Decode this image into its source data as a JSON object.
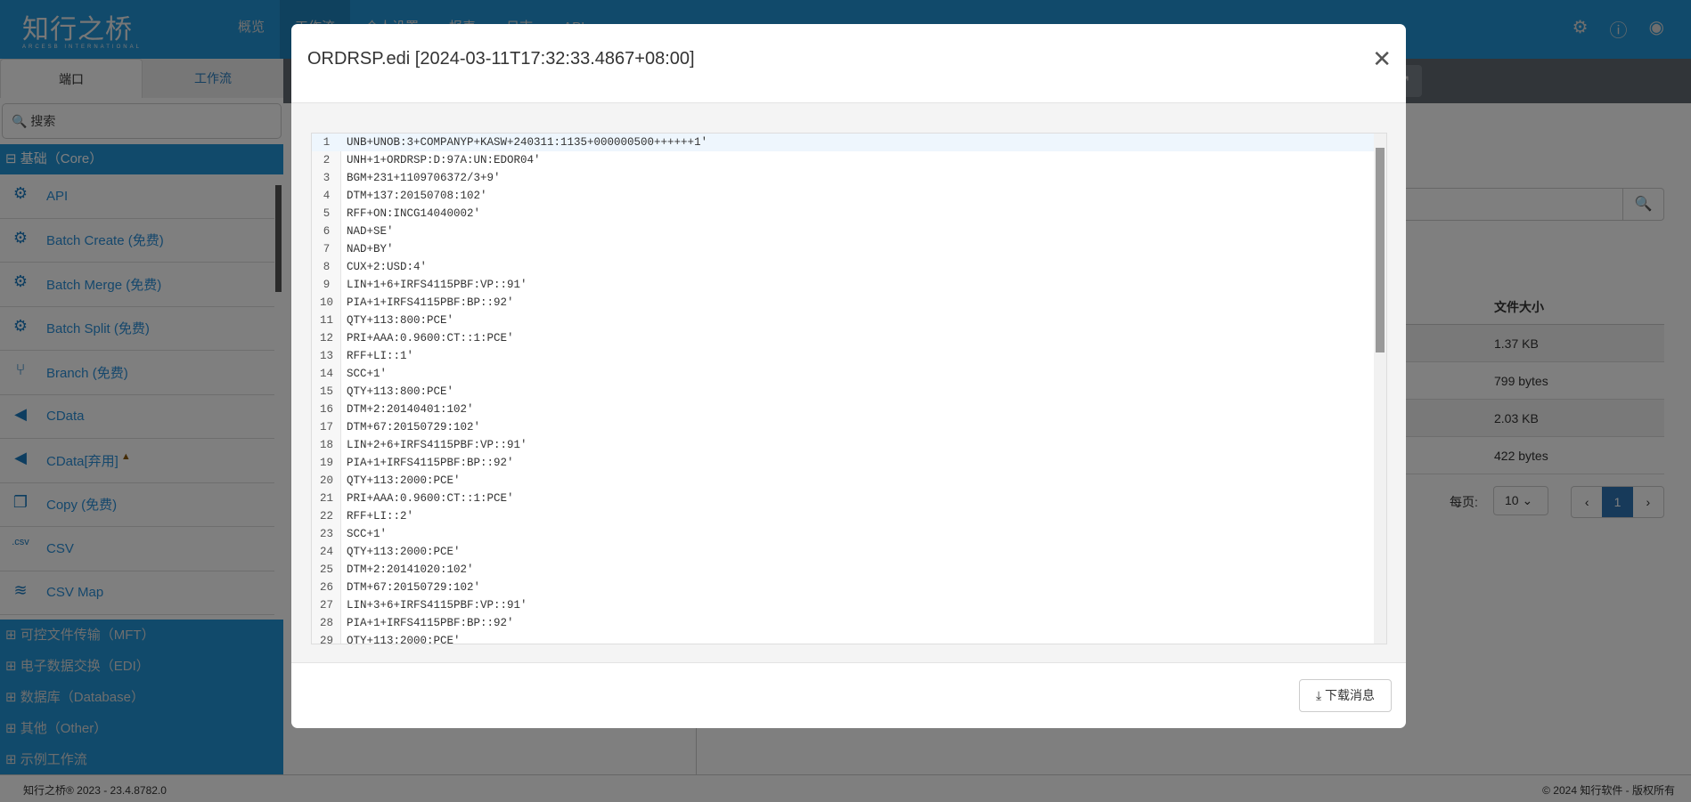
{
  "app": {
    "logo": "知行之桥",
    "logo_sub": "ARCESB INTERNATIONAL",
    "nav": [
      "概览",
      "工作流",
      "个人设置",
      "报表",
      "日志",
      "API"
    ],
    "header_icons": [
      "gear-icon",
      "help-icon",
      "user-icon"
    ]
  },
  "sidebar": {
    "tabs": [
      "端口",
      "工作流"
    ],
    "search_placeholder": "搜索",
    "core_group": "基础（Core）",
    "items": [
      {
        "label": "API",
        "icon": "api-icon"
      },
      {
        "label": "Batch Create (免费)",
        "icon": "batch-create-icon"
      },
      {
        "label": "Batch Merge (免费)",
        "icon": "batch-merge-icon"
      },
      {
        "label": "Batch Split (免费)",
        "icon": "batch-split-icon"
      },
      {
        "label": "Branch (免费)",
        "icon": "branch-icon"
      },
      {
        "label": "CData",
        "icon": "cdata-icon"
      },
      {
        "label": "CData[弃用]",
        "icon": "cdata-icon",
        "warning": true
      },
      {
        "label": "Copy (免费)",
        "icon": "copy-icon"
      },
      {
        "label": "CSV",
        "icon": "csv-icon"
      },
      {
        "label": "CSV Map",
        "icon": "csv-map-icon"
      }
    ],
    "groups": [
      "可控文件传输（MFT）",
      "电子数据交换（EDI）",
      "数据库（Database）",
      "其他（Other）",
      "示例工作流"
    ]
  },
  "table": {
    "header": "文件大小",
    "rows": [
      "1.37 KB",
      "799 bytes",
      "2.03 KB",
      "422 bytes"
    ],
    "per_page_label": "每页:",
    "per_page": "10",
    "page": "1"
  },
  "footer": {
    "left": "知行之桥® 2023 - 23.4.8782.0",
    "right": "© 2024 知行软件 - 版权所有"
  },
  "modal": {
    "title": "ORDRSP.edi [2024-03-11T17:32:33.4867+08:00]",
    "download_label": "下载消息",
    "lines": [
      "UNB+UNOB:3+COMPANYP+KASW+240311:1135+000000500++++++1'",
      "UNH+1+ORDRSP:D:97A:UN:EDOR04'",
      "BGM+231+1109706372/3+9'",
      "DTM+137:20150708:102'",
      "RFF+ON:INCG14040002'",
      "NAD+SE'",
      "NAD+BY'",
      "CUX+2:USD:4'",
      "LIN+1+6+IRFS4115PBF:VP::91'",
      "PIA+1+IRFS4115PBF:BP::92'",
      "QTY+113:800:PCE'",
      "PRI+AAA:0.9600:CT::1:PCE'",
      "RFF+LI::1'",
      "SCC+1'",
      "QTY+113:800:PCE'",
      "DTM+2:20140401:102'",
      "DTM+67:20150729:102'",
      "LIN+2+6+IRFS4115PBF:VP::91'",
      "PIA+1+IRFS4115PBF:BP::92'",
      "QTY+113:2000:PCE'",
      "PRI+AAA:0.9600:CT::1:PCE'",
      "RFF+LI::2'",
      "SCC+1'",
      "QTY+113:2000:PCE'",
      "DTM+2:20141020:102'",
      "DTM+67:20150729:102'",
      "LIN+3+6+IRFS4115PBF:VP::91'",
      "PIA+1+IRFS4115PBF:BP::92'",
      "QTY+113:2000:PCE'"
    ]
  }
}
